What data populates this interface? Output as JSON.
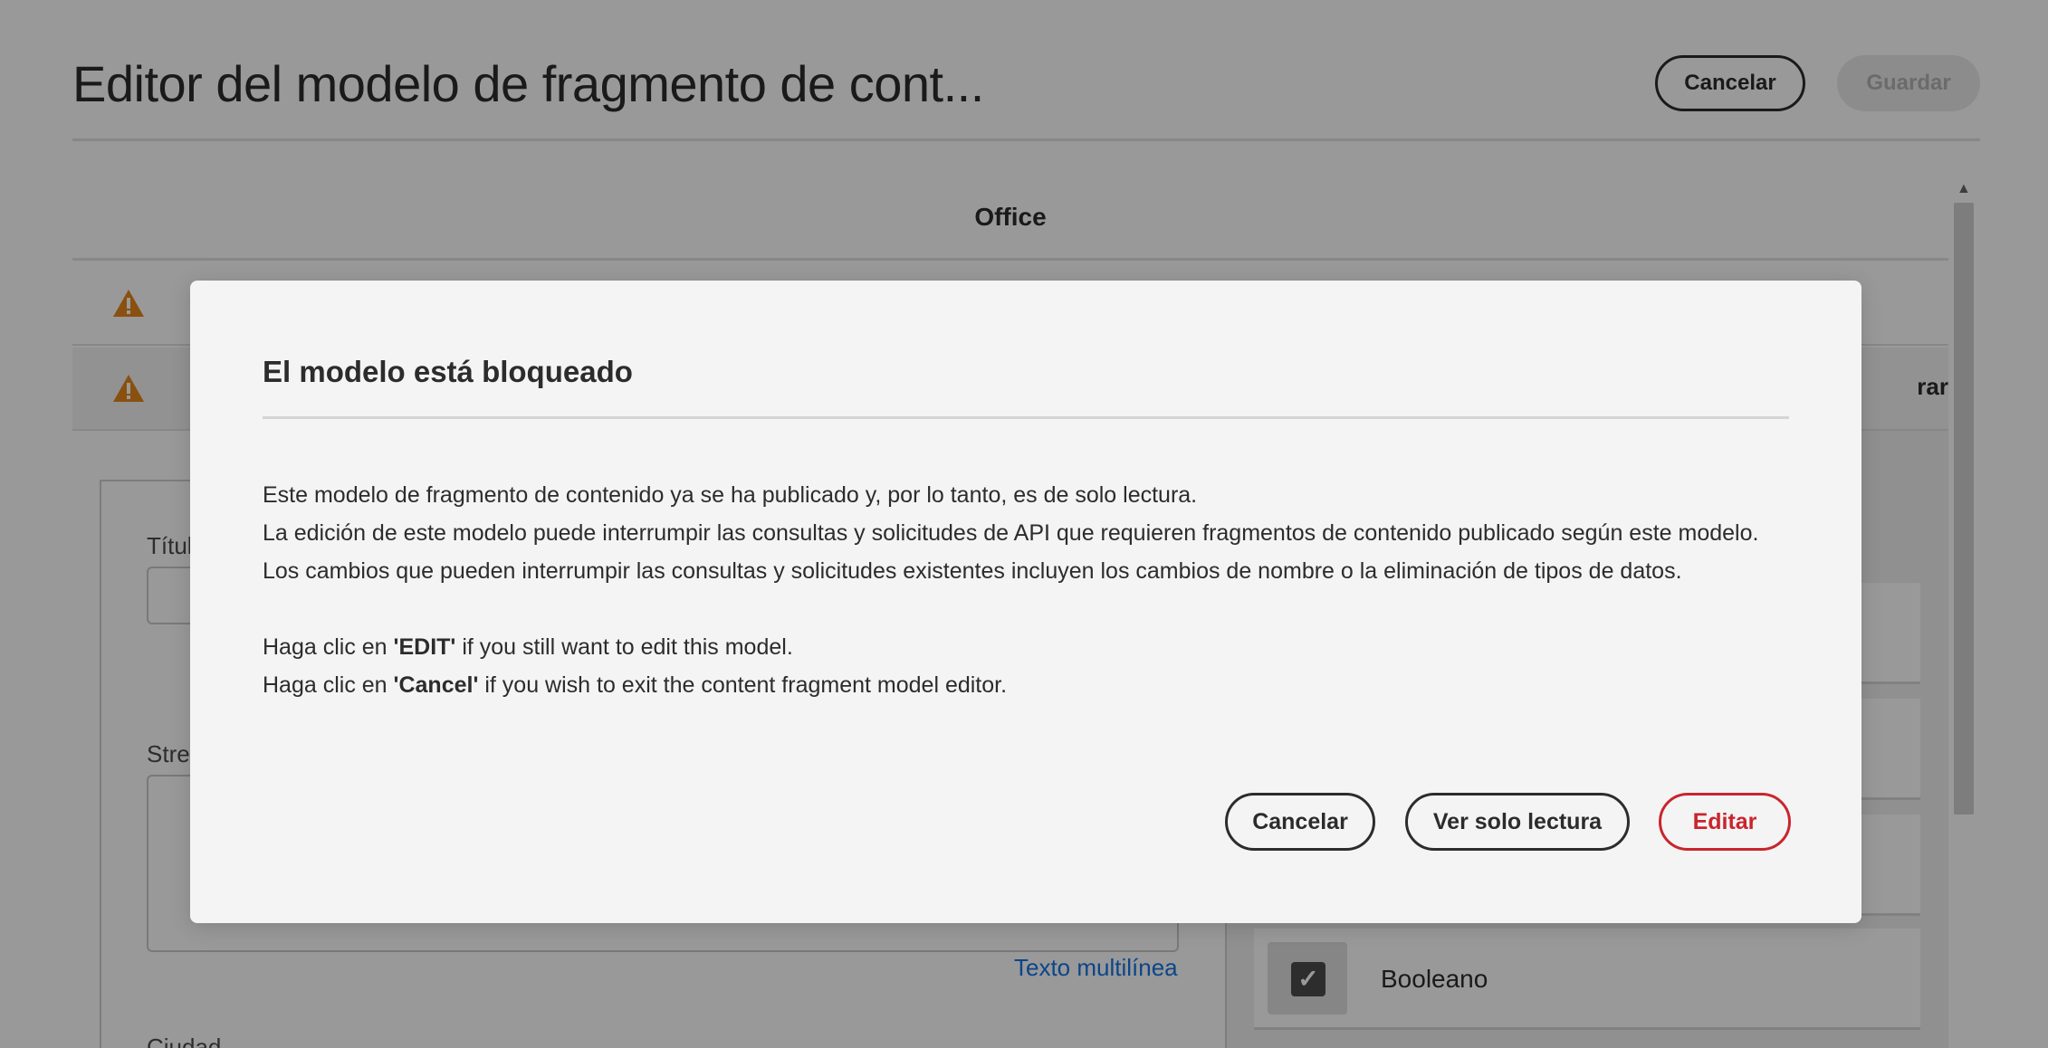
{
  "header": {
    "title": "Editor del modelo de fragmento de cont...",
    "cancel_label": "Cancelar",
    "save_label": "Guardar"
  },
  "tab": {
    "label": "Office"
  },
  "warnings": [
    {
      "action": ""
    },
    {
      "action": "rar"
    }
  ],
  "form": {
    "fields": [
      {
        "label": "Títul"
      },
      {
        "label": "Stree"
      },
      {
        "label": "Ciudad"
      }
    ],
    "multiline_type": "Texto multilínea"
  },
  "types": {
    "items": [
      {
        "name": ""
      },
      {
        "name": ""
      },
      {
        "name": ""
      },
      {
        "name": "Booleano"
      }
    ]
  },
  "dialog": {
    "title": "El modelo está bloqueado",
    "line1": "Este modelo de fragmento de contenido ya se ha publicado y, por lo tanto, es de solo lectura.",
    "line2": "La edición de este modelo puede interrumpir las consultas y solicitudes de API que requieren fragmentos de contenido publicado según este modelo.",
    "line3": "Los cambios que pueden interrumpir las consultas y solicitudes existentes incluyen los cambios de nombre o la eliminación de tipos de datos.",
    "line4_prefix": "Haga clic en ",
    "line4_key": "'EDIT'",
    "line4_suffix": " if you still want to edit this model.",
    "line5_prefix": "Haga clic en ",
    "line5_key": "'Cancel'",
    "line5_suffix": " if you wish to exit the content fragment model editor.",
    "cancel_label": "Cancelar",
    "readonly_label": "Ver solo lectura",
    "edit_label": "Editar"
  },
  "colors": {
    "warning": "#e68619",
    "link": "#1473e6",
    "danger": "#c9252d"
  }
}
